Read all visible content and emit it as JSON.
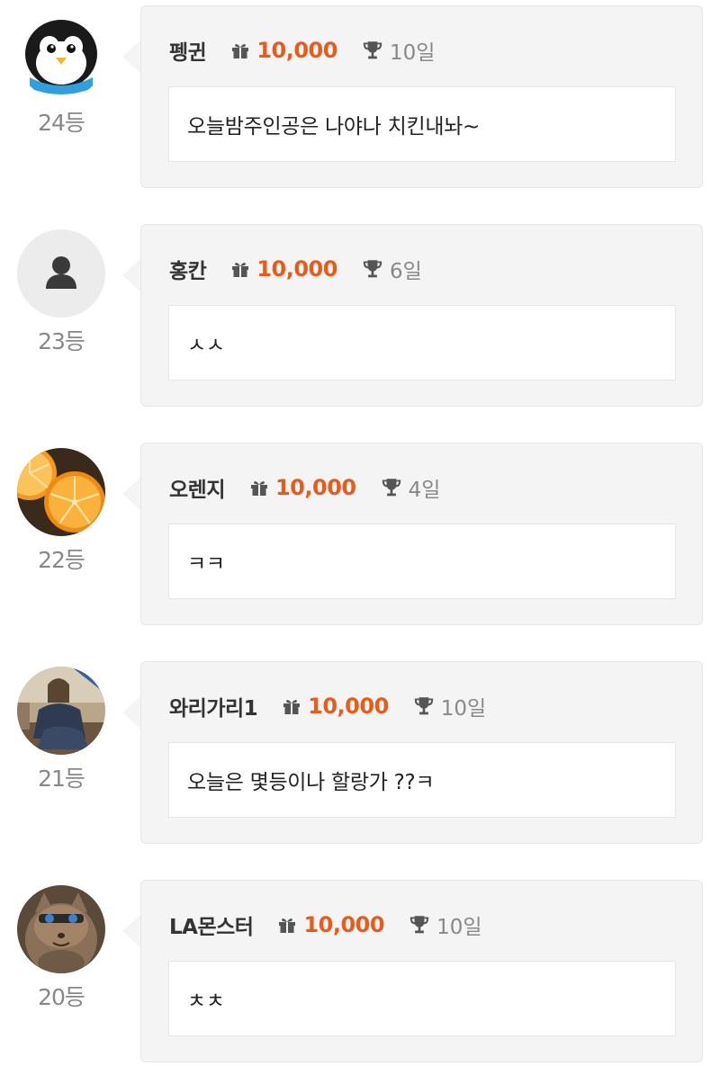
{
  "comments": [
    {
      "name": "펭귄",
      "amount": "10,000",
      "days": "10일",
      "message": "오늘밤주인공은 나야나 치킨내놔~",
      "rank": "24등",
      "avatar": "penguin-avatar"
    },
    {
      "name": "홍칸",
      "amount": "10,000",
      "days": "6일",
      "message": "ㅅㅅ",
      "rank": "23등",
      "avatar": "default-person-avatar"
    },
    {
      "name": "오렌지",
      "amount": "10,000",
      "days": "4일",
      "message": "ㅋㅋ",
      "rank": "22등",
      "avatar": "orange-photo-avatar"
    },
    {
      "name": "와리가리1",
      "amount": "10,000",
      "days": "10일",
      "message": "오늘은 몇등이나 할랑가 ??ㅋ",
      "rank": "21등",
      "avatar": "person-photo-avatar"
    },
    {
      "name": "LA몬스터",
      "amount": "10,000",
      "days": "10일",
      "message": "ㅊㅊ",
      "rank": "20등",
      "avatar": "cat-photo-avatar"
    }
  ],
  "icons": {
    "gift": "gift-icon",
    "trophy": "trophy-icon"
  },
  "colors": {
    "amount": "#e85c1b",
    "bubble_bg": "#f4f4f4",
    "muted_text": "#888888"
  }
}
